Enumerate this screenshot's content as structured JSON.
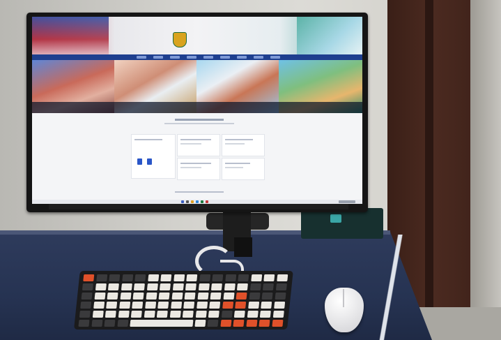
{
  "scene": {
    "objects": [
      "monitor",
      "keyboard",
      "mouse",
      "desk",
      "door"
    ],
    "desk_color": "#263352",
    "keyboard_accent": "#e0512a"
  },
  "screen": {
    "site_header": {
      "logo_icon": "crest-icon"
    },
    "navbar_items": 9,
    "banners": 4
  }
}
